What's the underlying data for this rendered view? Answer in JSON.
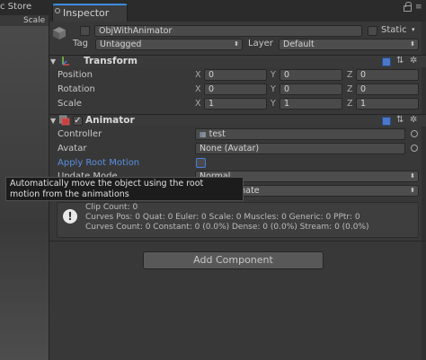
{
  "left_panel": {
    "tab_label": "c Store",
    "scale_label": "Scale"
  },
  "inspector": {
    "tab_label": "Inspector",
    "object_name": "ObjWithAnimator",
    "static_label": "Static",
    "tag_label": "Tag",
    "tag_value": "Untagged",
    "layer_label": "Layer",
    "layer_value": "Default"
  },
  "transform": {
    "title": "Transform",
    "rows": [
      {
        "label": "Position",
        "x": "0",
        "y": "0",
        "z": "0"
      },
      {
        "label": "Rotation",
        "x": "0",
        "y": "0",
        "z": "0"
      },
      {
        "label": "Scale",
        "x": "1",
        "y": "1",
        "z": "1"
      }
    ],
    "axis_x": "X",
    "axis_y": "Y",
    "axis_z": "Z"
  },
  "animator": {
    "title": "Animator",
    "controller_label": "Controller",
    "controller_value": "test",
    "avatar_label": "Avatar",
    "avatar_value": "None (Avatar)",
    "apply_root_motion_label": "Apply Root Motion",
    "update_mode_label": "Update Mode",
    "update_mode_value": "Normal",
    "culling_value": "mate"
  },
  "tooltip": {
    "line1": "Automatically move the object using the root",
    "line2": "motion from the animations"
  },
  "info": {
    "line1": "Clip Count: 0",
    "line2": "Curves Pos: 0 Quat: 0 Euler: 0 Scale: 0 Muscles: 0 Generic: 0 PPtr: 0",
    "line3": "Curves Count: 0 Constant: 0 (0.0%) Dense: 0 (0.0%) Stream: 0 (0.0%)"
  },
  "add_component_label": "Add Component",
  "colors": {
    "accent": "#3c8dde",
    "link_blue": "#5a8fe0",
    "bg": "#383838"
  }
}
